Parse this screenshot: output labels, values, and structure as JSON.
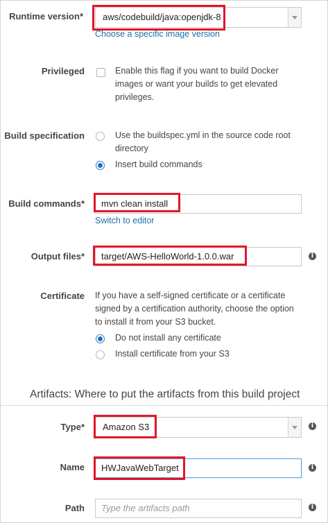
{
  "environment": {
    "runtime_version": {
      "label": "Runtime version",
      "required_mark": "*",
      "value": "aws/codebuild/java:openjdk-8",
      "link": "Choose a specific image version"
    },
    "privileged": {
      "label": "Privileged",
      "description": "Enable this flag if you want to build Docker images or want your builds to get elevated privileges.",
      "checked": false
    }
  },
  "buildspec": {
    "label": "Build specification",
    "options": [
      {
        "label": "Use the buildspec.yml in the source code root directory",
        "selected": false
      },
      {
        "label": "Insert build commands",
        "selected": true
      }
    ],
    "build_commands": {
      "label": "Build commands",
      "required_mark": "*",
      "value": "mvn clean install",
      "link": "Switch to editor"
    },
    "output_files": {
      "label": "Output files",
      "required_mark": "*",
      "value": "target/AWS-HelloWorld-1.0.0.war"
    }
  },
  "certificate": {
    "label": "Certificate",
    "description": "If you have a self-signed certificate or a certificate signed by a certification authority, choose the option to install it from your S3 bucket.",
    "options": [
      {
        "label": "Do not install any certificate",
        "selected": true
      },
      {
        "label": "Install certificate from your S3",
        "selected": false
      }
    ]
  },
  "artifacts": {
    "heading": "Artifacts: Where to put the artifacts from this build project",
    "type": {
      "label": "Type",
      "required_mark": "*",
      "value": "Amazon S3"
    },
    "name": {
      "label": "Name",
      "value": "HWJavaWebTarget"
    },
    "path": {
      "label": "Path",
      "placeholder": "Type the artifacts path",
      "value": ""
    }
  },
  "info_icon_glyph": "i",
  "colors": {
    "highlight": "#e0162b",
    "link": "#1f6ea8",
    "radio_selected": "#1f6ec0"
  }
}
